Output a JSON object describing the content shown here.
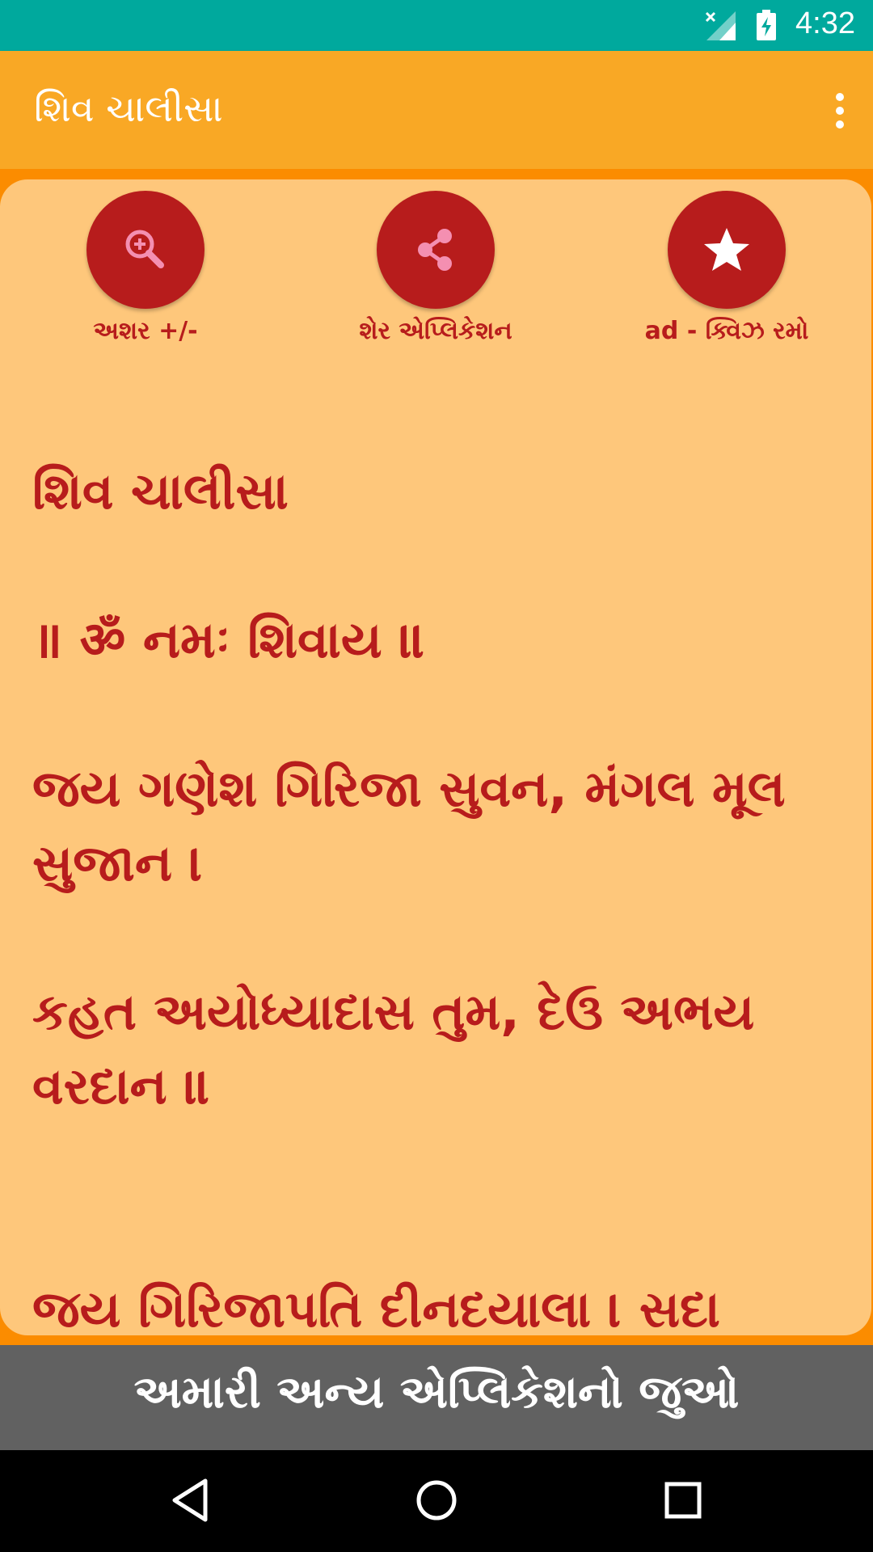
{
  "status_bar": {
    "time": "4:32"
  },
  "app_bar": {
    "title": "શિવ ચાલીસા"
  },
  "actions": [
    {
      "label": "અશર +/-",
      "icon": "zoom-in-icon"
    },
    {
      "label": "શેર એપ્લિકેશન",
      "icon": "share-icon"
    },
    {
      "label": "ad - ક્વિઝ રમો",
      "icon": "star-icon"
    }
  ],
  "content": {
    "heading": "શિવ ચાલીસા",
    "verses": [
      "॥ ॐ નમઃ શિવાય ॥",
      "જય ગણેશ ગિરિજા સુવન, મંગલ મૂલ સુજાન ।",
      "કહત અયોધ્યાદાસ તુમ, દેઉ અભય વરદાન ॥",
      "જય ગિરિજાપતિ દીનદયાલા । સદા"
    ]
  },
  "bottom_banner": {
    "text": "અમારી અન્ય એપ્લિકેશનો જુઓ"
  },
  "colors": {
    "status_bar": "#00A99D",
    "app_bar": "#F9A825",
    "card": "#FEC77B",
    "accent": "#B71C1C",
    "banner": "#616161"
  }
}
